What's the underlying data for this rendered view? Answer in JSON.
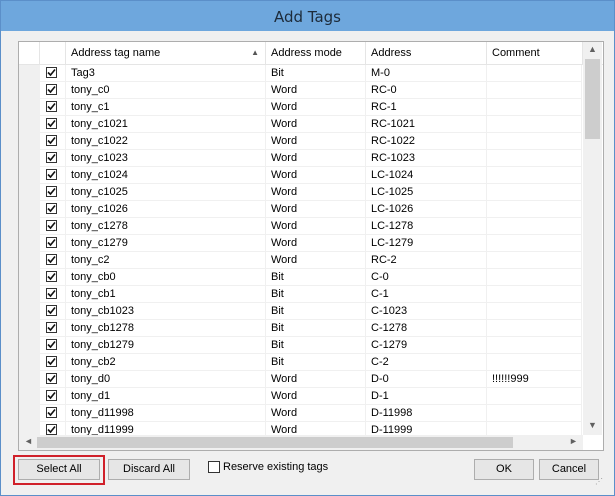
{
  "dialog": {
    "title": "Add Tags"
  },
  "table": {
    "columns": [
      {
        "key": "name",
        "label": "Address tag name"
      },
      {
        "key": "mode",
        "label": "Address mode"
      },
      {
        "key": "address",
        "label": "Address"
      },
      {
        "key": "comment",
        "label": "Comment"
      }
    ],
    "sort_icon": "sort-up-icon",
    "rows": [
      {
        "checked": true,
        "name": "Tag3",
        "mode": "Bit",
        "address": "M-0",
        "comment": ""
      },
      {
        "checked": true,
        "name": "tony_c0",
        "mode": "Word",
        "address": "RC-0",
        "comment": ""
      },
      {
        "checked": true,
        "name": "tony_c1",
        "mode": "Word",
        "address": "RC-1",
        "comment": ""
      },
      {
        "checked": true,
        "name": "tony_c1021",
        "mode": "Word",
        "address": "RC-1021",
        "comment": ""
      },
      {
        "checked": true,
        "name": "tony_c1022",
        "mode": "Word",
        "address": "RC-1022",
        "comment": ""
      },
      {
        "checked": true,
        "name": "tony_c1023",
        "mode": "Word",
        "address": "RC-1023",
        "comment": ""
      },
      {
        "checked": true,
        "name": "tony_c1024",
        "mode": "Word",
        "address": "LC-1024",
        "comment": ""
      },
      {
        "checked": true,
        "name": "tony_c1025",
        "mode": "Word",
        "address": "LC-1025",
        "comment": ""
      },
      {
        "checked": true,
        "name": "tony_c1026",
        "mode": "Word",
        "address": "LC-1026",
        "comment": ""
      },
      {
        "checked": true,
        "name": "tony_c1278",
        "mode": "Word",
        "address": "LC-1278",
        "comment": ""
      },
      {
        "checked": true,
        "name": "tony_c1279",
        "mode": "Word",
        "address": "LC-1279",
        "comment": ""
      },
      {
        "checked": true,
        "name": "tony_c2",
        "mode": "Word",
        "address": "RC-2",
        "comment": ""
      },
      {
        "checked": true,
        "name": "tony_cb0",
        "mode": "Bit",
        "address": "C-0",
        "comment": ""
      },
      {
        "checked": true,
        "name": "tony_cb1",
        "mode": "Bit",
        "address": "C-1",
        "comment": ""
      },
      {
        "checked": true,
        "name": "tony_cb1023",
        "mode": "Bit",
        "address": "C-1023",
        "comment": ""
      },
      {
        "checked": true,
        "name": "tony_cb1278",
        "mode": "Bit",
        "address": "C-1278",
        "comment": ""
      },
      {
        "checked": true,
        "name": "tony_cb1279",
        "mode": "Bit",
        "address": "C-1279",
        "comment": ""
      },
      {
        "checked": true,
        "name": "tony_cb2",
        "mode": "Bit",
        "address": "C-2",
        "comment": ""
      },
      {
        "checked": true,
        "name": "tony_d0",
        "mode": "Word",
        "address": "D-0",
        "comment": "!!!!!!999"
      },
      {
        "checked": true,
        "name": "tony_d1",
        "mode": "Word",
        "address": "D-1",
        "comment": ""
      },
      {
        "checked": true,
        "name": "tony_d11998",
        "mode": "Word",
        "address": "D-11998",
        "comment": ""
      },
      {
        "checked": true,
        "name": "tony_d11999",
        "mode": "Word",
        "address": "D-11999",
        "comment": ""
      }
    ]
  },
  "scroll": {
    "up": "▲",
    "down": "▼",
    "left": "◄",
    "right": "►"
  },
  "buttons": {
    "select_all": "Select All",
    "discard_all": "Discard All",
    "ok": "OK",
    "cancel": "Cancel"
  },
  "reserve": {
    "label": "Reserve existing tags",
    "checked": false
  }
}
